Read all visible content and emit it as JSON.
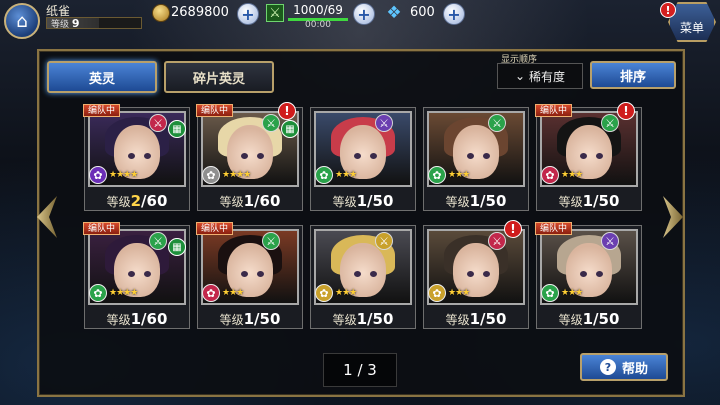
{
  "player": {
    "name": "纸雀",
    "level_label": "等级",
    "level_value": "9",
    "exp_fraction": 0.55
  },
  "currency": {
    "coins": "2689800",
    "stamina": "1000/69",
    "stamina_timer": "00:00",
    "stamina_fraction": 1.0,
    "gems": "600",
    "plus": "+"
  },
  "menu": {
    "label": "菜单",
    "alert": "!"
  },
  "tabs": [
    {
      "label": "英灵"
    },
    {
      "label": "碎片英灵"
    }
  ],
  "sort": {
    "caption": "显示顺序",
    "value": "稀有度",
    "button": "排序"
  },
  "level_label": "等级",
  "squad_label": "编队中",
  "cards": [
    {
      "cur": "2",
      "max": "/60",
      "squad": true,
      "alert": false,
      "weapon_color": "#c2274b",
      "element_color": "#6b2fb7",
      "hair": "#2b2046",
      "bg": "#3a2a5a",
      "stars": "★★★★",
      "book": true
    },
    {
      "cur": "1",
      "max": "/60",
      "squad": true,
      "alert": true,
      "weapon_color": "#2aa24a",
      "element_color": "#8f8f8f",
      "hair": "#e7d7a8",
      "bg": "#6a5a4a",
      "stars": "★★★★",
      "book": true
    },
    {
      "cur": "1",
      "max": "/50",
      "squad": false,
      "alert": false,
      "weapon_color": "#6b3fb0",
      "element_color": "#2aa24a",
      "hair": "#c83c4a",
      "bg": "#3a4a6a",
      "stars": "★★★",
      "book": false
    },
    {
      "cur": "1",
      "max": "/50",
      "squad": false,
      "alert": false,
      "weapon_color": "#2aa24a",
      "element_color": "#2aa24a",
      "hair": "#6b4530",
      "bg": "#6a4a34",
      "stars": "★★★",
      "book": false
    },
    {
      "cur": "1",
      "max": "/50",
      "squad": true,
      "alert": true,
      "weapon_color": "#2aa24a",
      "element_color": "#c2274b",
      "hair": "#141414",
      "bg": "#5a3030",
      "stars": "★★★",
      "book": false
    },
    {
      "cur": "1",
      "max": "/60",
      "squad": true,
      "alert": false,
      "weapon_color": "#2aa24a",
      "element_color": "#2aa24a",
      "hair": "#2e1a3a",
      "bg": "#3a2040",
      "stars": "★★★★",
      "book": true
    },
    {
      "cur": "1",
      "max": "/50",
      "squad": true,
      "alert": false,
      "weapon_color": "#2aa24a",
      "element_color": "#c2274b",
      "hair": "#1a1010",
      "bg": "#7a3a24",
      "stars": "★★★",
      "book": false
    },
    {
      "cur": "1",
      "max": "/50",
      "squad": false,
      "alert": false,
      "weapon_color": "#c9a12b",
      "element_color": "#c9a12b",
      "hair": "#d9b858",
      "bg": "#4a4a52",
      "stars": "★★★",
      "book": false
    },
    {
      "cur": "1",
      "max": "/50",
      "squad": false,
      "alert": true,
      "weapon_color": "#c2274b",
      "element_color": "#c9a12b",
      "hair": "#3a3028",
      "bg": "#5a4a3a",
      "stars": "★★★",
      "book": false
    },
    {
      "cur": "1",
      "max": "/50",
      "squad": true,
      "alert": false,
      "weapon_color": "#6b3fb0",
      "element_color": "#2aa24a",
      "hair": "#b7a690",
      "bg": "#5a5048",
      "stars": "★★★",
      "book": false
    }
  ],
  "pager": {
    "text": "1 / 3"
  },
  "help": {
    "label": "帮助",
    "icon": "?"
  }
}
